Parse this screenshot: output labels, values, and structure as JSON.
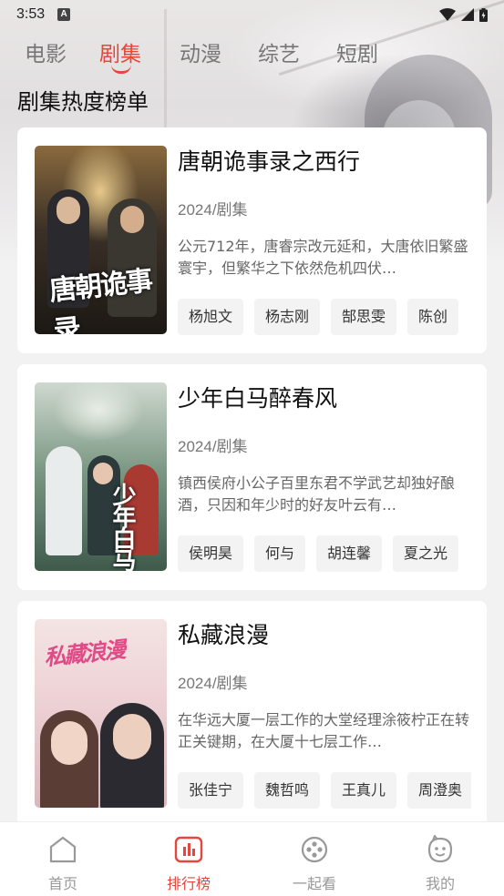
{
  "status_bar": {
    "time": "3:53",
    "notification_badge": "A"
  },
  "category_tabs": [
    {
      "label": "电影",
      "active": false
    },
    {
      "label": "剧集",
      "active": true
    },
    {
      "label": "动漫",
      "active": false
    },
    {
      "label": "综艺",
      "active": false
    },
    {
      "label": "短剧",
      "active": false
    }
  ],
  "section_title": "剧集热度榜单",
  "items": [
    {
      "title": "唐朝诡事录之西行",
      "meta": "2024/剧集",
      "description": "公元712年，唐睿宗改元延和，大唐依旧繁盛寰宇，但繁华之下依然危机四伏…",
      "cast": [
        "杨旭文",
        "杨志刚",
        "郜思雯",
        "陈创"
      ],
      "poster_text": "唐朝诡事录"
    },
    {
      "title": "少年白马醉春风",
      "meta": "2024/剧集",
      "description": "镇西侯府小公子百里东君不学武艺却独好酿酒，只因和年少时的好友叶云有…",
      "cast": [
        "侯明昊",
        "何与",
        "胡连馨",
        "夏之光"
      ],
      "poster_text": "少年白马"
    },
    {
      "title": "私藏浪漫",
      "meta": "2024/剧集",
      "description": "在华远大厦一层工作的大堂经理涂筱柠正在转正关键期，在大厦十七层工作…",
      "cast": [
        "张佳宁",
        "魏哲鸣",
        "王真儿",
        "周澄奥"
      ],
      "poster_text": "私藏浪漫"
    }
  ],
  "bottom_nav": [
    {
      "label": "首页",
      "icon": "home-icon",
      "active": false
    },
    {
      "label": "排行榜",
      "icon": "ranking-icon",
      "active": true
    },
    {
      "label": "一起看",
      "icon": "watch-together-icon",
      "active": false
    },
    {
      "label": "我的",
      "icon": "profile-icon",
      "active": false
    }
  ],
  "colors": {
    "accent": "#e4473b",
    "muted": "#999999"
  }
}
